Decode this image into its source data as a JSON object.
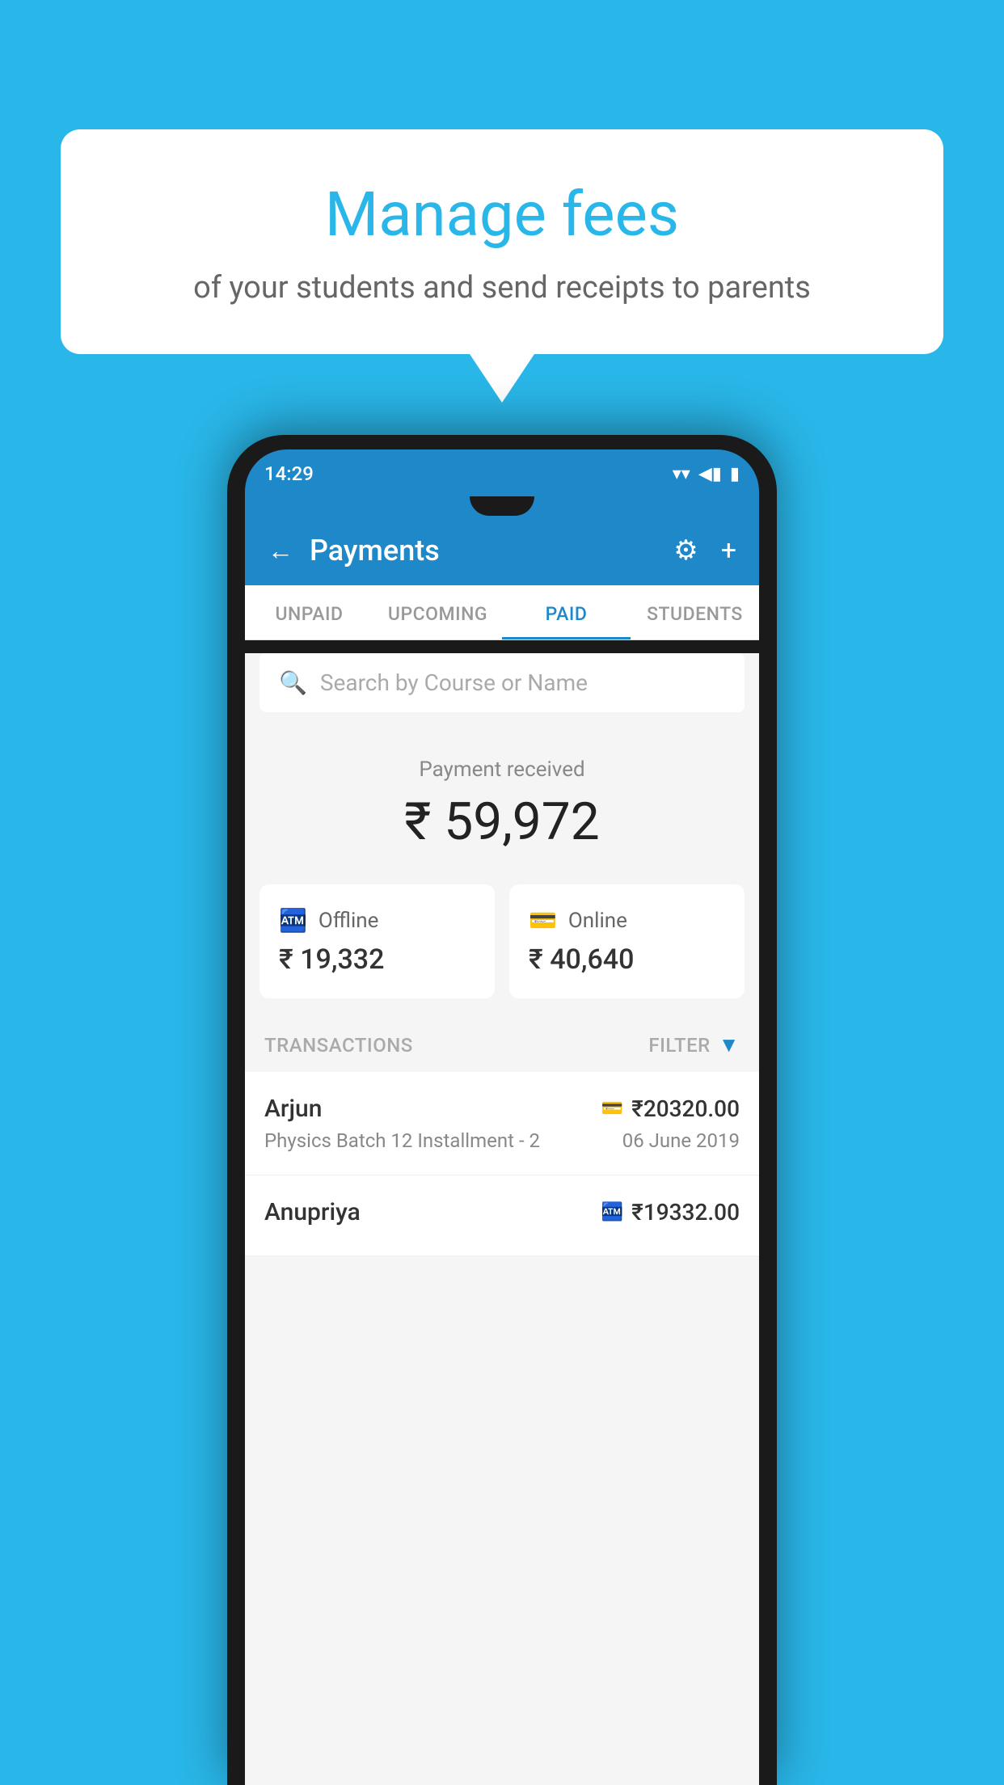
{
  "background_color": "#29b6e8",
  "speech_bubble": {
    "title": "Manage fees",
    "subtitle": "of your students and send receipts to parents"
  },
  "status_bar": {
    "time": "14:29",
    "wifi": "▼",
    "signal": "▲",
    "battery": "▮"
  },
  "header": {
    "title": "Payments",
    "back_label": "←",
    "settings_label": "⚙",
    "add_label": "+"
  },
  "tabs": [
    {
      "label": "UNPAID",
      "active": false
    },
    {
      "label": "UPCOMING",
      "active": false
    },
    {
      "label": "PAID",
      "active": true
    },
    {
      "label": "STUDENTS",
      "active": false
    }
  ],
  "search": {
    "placeholder": "Search by Course or Name"
  },
  "payment_received": {
    "label": "Payment received",
    "amount": "₹ 59,972"
  },
  "cards": [
    {
      "type": "Offline",
      "amount": "₹ 19,332",
      "icon": "offline"
    },
    {
      "type": "Online",
      "amount": "₹ 40,640",
      "icon": "online"
    }
  ],
  "transactions_label": "TRANSACTIONS",
  "filter_label": "FILTER",
  "transactions": [
    {
      "name": "Arjun",
      "course": "Physics Batch 12 Installment - 2",
      "date": "06 June 2019",
      "amount": "₹20320.00",
      "mode": "online"
    },
    {
      "name": "Anupriya",
      "course": "",
      "date": "",
      "amount": "₹19332.00",
      "mode": "offline"
    }
  ]
}
